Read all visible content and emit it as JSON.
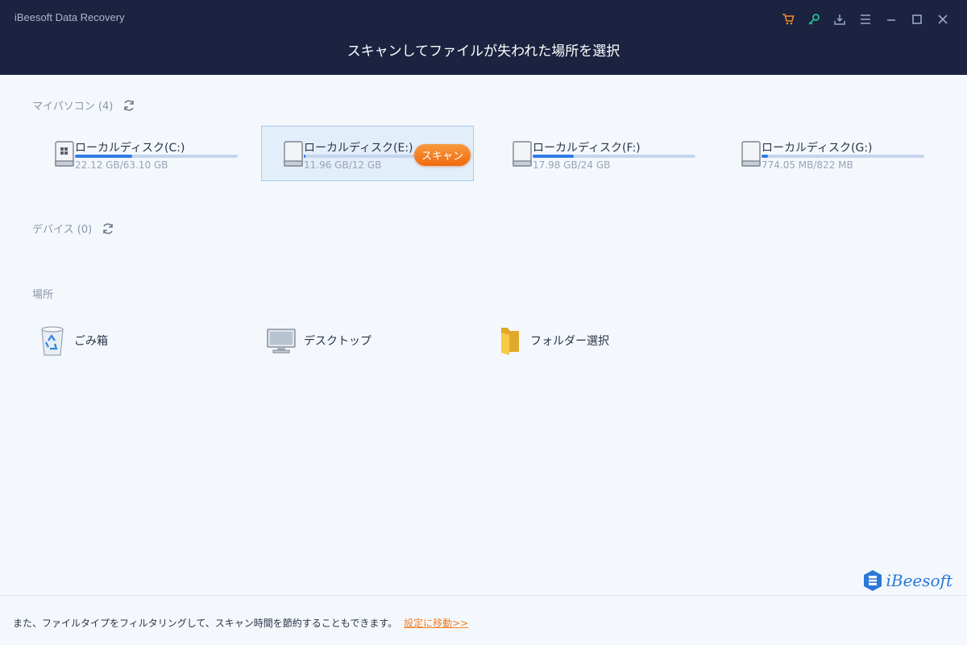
{
  "window": {
    "app_title": "iBeesoft Data Recovery",
    "main_title": "スキャンしてファイルが失われた場所を選択",
    "icons": [
      "cart-icon",
      "key-icon",
      "download-icon",
      "menu-icon",
      "minimize-icon",
      "maximize-icon",
      "close-icon"
    ],
    "colors": {
      "cart": "#f08a24",
      "key": "#22c38e",
      "default": "#9aa7c7"
    }
  },
  "my_pc": {
    "label": "マイパソコン (4)",
    "disks": [
      {
        "name": "ローカルディスク(C:)",
        "size": "22.12 GB/63.10 GB",
        "used_fraction": 0.35,
        "selected": false,
        "type": "system"
      },
      {
        "name": "ローカルディスク(E:)",
        "size": "11.96 GB/12 GB",
        "used_fraction": 0.01,
        "selected": true,
        "type": "drive"
      },
      {
        "name": "ローカルディスク(F:)",
        "size": "17.98 GB/24 GB",
        "used_fraction": 0.25,
        "selected": false,
        "type": "drive"
      },
      {
        "name": "ローカルディスク(G:)",
        "size": "774.05 MB/822 MB",
        "used_fraction": 0.04,
        "selected": false,
        "type": "drive"
      }
    ],
    "scan_label": "スキャン"
  },
  "devices": {
    "label": "デバイス (0)"
  },
  "locations": {
    "label": "場所",
    "items": [
      {
        "name": "ごみ箱",
        "icon": "recycle-bin-icon"
      },
      {
        "name": "デスクトップ",
        "icon": "desktop-icon"
      },
      {
        "name": "フォルダー選択",
        "icon": "folder-icon"
      }
    ]
  },
  "footer": {
    "text": "また、ファイルタイプをフィルタリングして、スキャン時間を節約することもできます。",
    "link": "設定に移動>>"
  },
  "brand": {
    "logo_text": "iBeesoft",
    "color": "#2a78d8"
  }
}
